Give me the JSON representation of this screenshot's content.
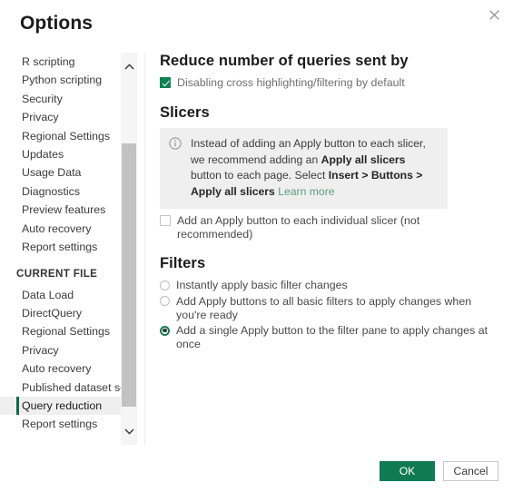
{
  "dialog": {
    "title": "Options",
    "close_icon": "close-icon"
  },
  "sidebar": {
    "global_items": [
      {
        "label": "R scripting"
      },
      {
        "label": "Python scripting"
      },
      {
        "label": "Security"
      },
      {
        "label": "Privacy"
      },
      {
        "label": "Regional Settings"
      },
      {
        "label": "Updates"
      },
      {
        "label": "Usage Data"
      },
      {
        "label": "Diagnostics"
      },
      {
        "label": "Preview features"
      },
      {
        "label": "Auto recovery"
      },
      {
        "label": "Report settings"
      }
    ],
    "group_label": "CURRENT FILE",
    "current_file_items": [
      {
        "label": "Data Load"
      },
      {
        "label": "DirectQuery"
      },
      {
        "label": "Regional Settings"
      },
      {
        "label": "Privacy"
      },
      {
        "label": "Auto recovery"
      },
      {
        "label": "Published dataset set..."
      },
      {
        "label": "Query reduction"
      },
      {
        "label": "Report settings"
      }
    ],
    "selected": "Query reduction",
    "scrollbar": {
      "up_arrow_icon": "chevron-up-icon",
      "down_arrow_icon": "chevron-down-icon"
    }
  },
  "content": {
    "reduce_queries": {
      "heading": "Reduce number of queries sent by",
      "checkbox_label": "Disabling cross highlighting/filtering by default",
      "checkbox_checked": true
    },
    "slicers": {
      "heading": "Slicers",
      "info_icon": "info-circle-icon",
      "info_text_1": "Instead of adding an Apply button to each slicer, we recommend adding an ",
      "info_bold_1": "Apply all slicers",
      "info_text_2": " button to each page. Select ",
      "info_bold_2": "Insert > Buttons > Apply all slicers",
      "info_link": "Learn more",
      "checkbox_label": "Add an Apply button to each individual slicer (not recommended)",
      "checkbox_checked": false
    },
    "filters": {
      "heading": "Filters",
      "options": [
        {
          "label": "Instantly apply basic filter changes",
          "selected": false
        },
        {
          "label": "Add Apply buttons to all basic filters to apply changes when you're ready",
          "selected": false
        },
        {
          "label": "Add a single Apply button to the filter pane to apply changes at once",
          "selected": true
        }
      ]
    }
  },
  "footer": {
    "ok_label": "OK",
    "cancel_label": "Cancel"
  },
  "colors": {
    "accent_green": "#107a53",
    "selection_bar": "#0e6b4b",
    "link": "#5d9b82",
    "info_bg": "#efefef"
  }
}
